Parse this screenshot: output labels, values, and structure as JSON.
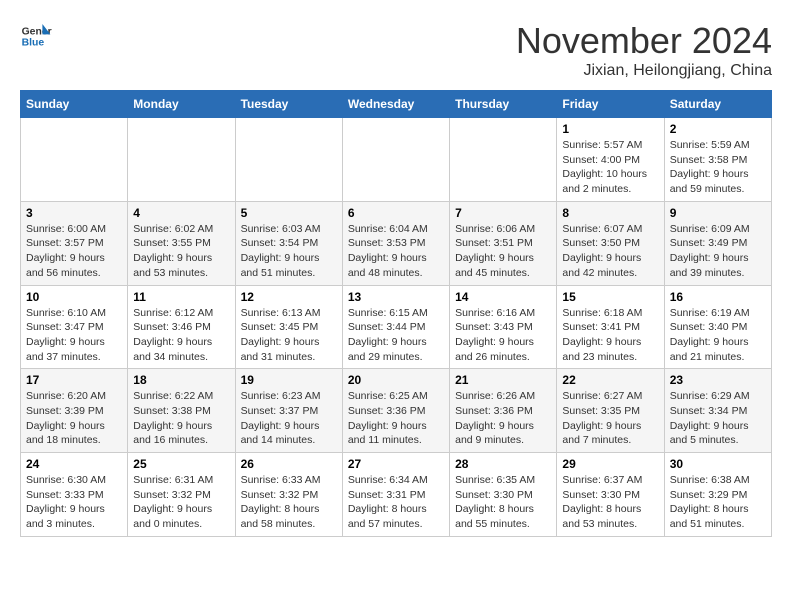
{
  "logo": {
    "line1": "General",
    "line2": "Blue"
  },
  "title": "November 2024",
  "location": "Jixian, Heilongjiang, China",
  "days_of_week": [
    "Sunday",
    "Monday",
    "Tuesday",
    "Wednesday",
    "Thursday",
    "Friday",
    "Saturday"
  ],
  "weeks": [
    [
      {
        "day": "",
        "info": ""
      },
      {
        "day": "",
        "info": ""
      },
      {
        "day": "",
        "info": ""
      },
      {
        "day": "",
        "info": ""
      },
      {
        "day": "",
        "info": ""
      },
      {
        "day": "1",
        "info": "Sunrise: 5:57 AM\nSunset: 4:00 PM\nDaylight: 10 hours and 2 minutes."
      },
      {
        "day": "2",
        "info": "Sunrise: 5:59 AM\nSunset: 3:58 PM\nDaylight: 9 hours and 59 minutes."
      }
    ],
    [
      {
        "day": "3",
        "info": "Sunrise: 6:00 AM\nSunset: 3:57 PM\nDaylight: 9 hours and 56 minutes."
      },
      {
        "day": "4",
        "info": "Sunrise: 6:02 AM\nSunset: 3:55 PM\nDaylight: 9 hours and 53 minutes."
      },
      {
        "day": "5",
        "info": "Sunrise: 6:03 AM\nSunset: 3:54 PM\nDaylight: 9 hours and 51 minutes."
      },
      {
        "day": "6",
        "info": "Sunrise: 6:04 AM\nSunset: 3:53 PM\nDaylight: 9 hours and 48 minutes."
      },
      {
        "day": "7",
        "info": "Sunrise: 6:06 AM\nSunset: 3:51 PM\nDaylight: 9 hours and 45 minutes."
      },
      {
        "day": "8",
        "info": "Sunrise: 6:07 AM\nSunset: 3:50 PM\nDaylight: 9 hours and 42 minutes."
      },
      {
        "day": "9",
        "info": "Sunrise: 6:09 AM\nSunset: 3:49 PM\nDaylight: 9 hours and 39 minutes."
      }
    ],
    [
      {
        "day": "10",
        "info": "Sunrise: 6:10 AM\nSunset: 3:47 PM\nDaylight: 9 hours and 37 minutes."
      },
      {
        "day": "11",
        "info": "Sunrise: 6:12 AM\nSunset: 3:46 PM\nDaylight: 9 hours and 34 minutes."
      },
      {
        "day": "12",
        "info": "Sunrise: 6:13 AM\nSunset: 3:45 PM\nDaylight: 9 hours and 31 minutes."
      },
      {
        "day": "13",
        "info": "Sunrise: 6:15 AM\nSunset: 3:44 PM\nDaylight: 9 hours and 29 minutes."
      },
      {
        "day": "14",
        "info": "Sunrise: 6:16 AM\nSunset: 3:43 PM\nDaylight: 9 hours and 26 minutes."
      },
      {
        "day": "15",
        "info": "Sunrise: 6:18 AM\nSunset: 3:41 PM\nDaylight: 9 hours and 23 minutes."
      },
      {
        "day": "16",
        "info": "Sunrise: 6:19 AM\nSunset: 3:40 PM\nDaylight: 9 hours and 21 minutes."
      }
    ],
    [
      {
        "day": "17",
        "info": "Sunrise: 6:20 AM\nSunset: 3:39 PM\nDaylight: 9 hours and 18 minutes."
      },
      {
        "day": "18",
        "info": "Sunrise: 6:22 AM\nSunset: 3:38 PM\nDaylight: 9 hours and 16 minutes."
      },
      {
        "day": "19",
        "info": "Sunrise: 6:23 AM\nSunset: 3:37 PM\nDaylight: 9 hours and 14 minutes."
      },
      {
        "day": "20",
        "info": "Sunrise: 6:25 AM\nSunset: 3:36 PM\nDaylight: 9 hours and 11 minutes."
      },
      {
        "day": "21",
        "info": "Sunrise: 6:26 AM\nSunset: 3:36 PM\nDaylight: 9 hours and 9 minutes."
      },
      {
        "day": "22",
        "info": "Sunrise: 6:27 AM\nSunset: 3:35 PM\nDaylight: 9 hours and 7 minutes."
      },
      {
        "day": "23",
        "info": "Sunrise: 6:29 AM\nSunset: 3:34 PM\nDaylight: 9 hours and 5 minutes."
      }
    ],
    [
      {
        "day": "24",
        "info": "Sunrise: 6:30 AM\nSunset: 3:33 PM\nDaylight: 9 hours and 3 minutes."
      },
      {
        "day": "25",
        "info": "Sunrise: 6:31 AM\nSunset: 3:32 PM\nDaylight: 9 hours and 0 minutes."
      },
      {
        "day": "26",
        "info": "Sunrise: 6:33 AM\nSunset: 3:32 PM\nDaylight: 8 hours and 58 minutes."
      },
      {
        "day": "27",
        "info": "Sunrise: 6:34 AM\nSunset: 3:31 PM\nDaylight: 8 hours and 57 minutes."
      },
      {
        "day": "28",
        "info": "Sunrise: 6:35 AM\nSunset: 3:30 PM\nDaylight: 8 hours and 55 minutes."
      },
      {
        "day": "29",
        "info": "Sunrise: 6:37 AM\nSunset: 3:30 PM\nDaylight: 8 hours and 53 minutes."
      },
      {
        "day": "30",
        "info": "Sunrise: 6:38 AM\nSunset: 3:29 PM\nDaylight: 8 hours and 51 minutes."
      }
    ]
  ]
}
